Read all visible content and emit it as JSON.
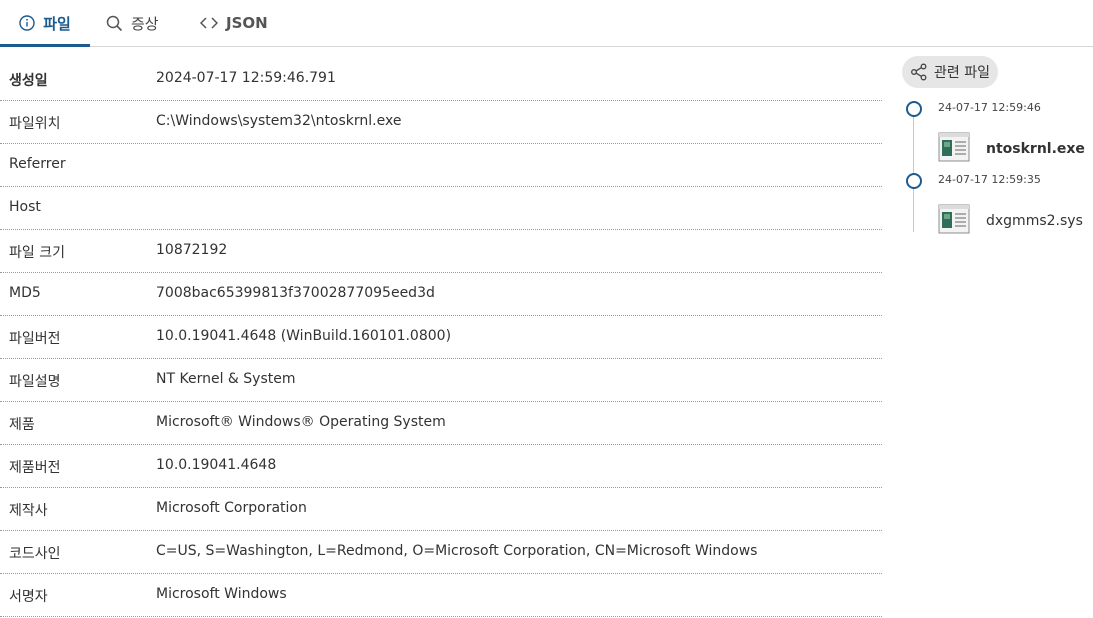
{
  "tabs": {
    "file": "파일",
    "symptom": "증상",
    "json": "JSON"
  },
  "details": [
    {
      "label": "생성일",
      "value": "2024-07-17 12:59:46.791"
    },
    {
      "label": "파일위치",
      "value": "C:\\Windows\\system32\\ntoskrnl.exe"
    },
    {
      "label": "Referrer",
      "value": ""
    },
    {
      "label": "Host",
      "value": ""
    },
    {
      "label": "파일 크기",
      "value": "10872192"
    },
    {
      "label": "MD5",
      "value": "7008bac65399813f37002877095eed3d"
    },
    {
      "label": "파일버전",
      "value": "10.0.19041.4648 (WinBuild.160101.0800)"
    },
    {
      "label": "파일설명",
      "value": "NT Kernel & System"
    },
    {
      "label": "제품",
      "value": "Microsoft® Windows® Operating System"
    },
    {
      "label": "제품버전",
      "value": "10.0.19041.4648"
    },
    {
      "label": "제작사",
      "value": "Microsoft Corporation"
    },
    {
      "label": "코드사인",
      "value": "C=US, S=Washington, L=Redmond, O=Microsoft Corporation, CN=Microsoft Windows"
    },
    {
      "label": "서명자",
      "value": "Microsoft Windows"
    }
  ],
  "related": {
    "button_label": "관련 파일",
    "items": [
      {
        "date": "24-07-17 12:59:46",
        "name": "ntoskrnl.exe"
      },
      {
        "date": "24-07-17 12:59:35",
        "name": "dxgmms2.sys"
      }
    ]
  },
  "colors": {
    "accent": "#1d5b8e",
    "divider": "#9a9a9a",
    "pill_bg": "#e6e6e6"
  },
  "icons": {
    "file_tab": "info-icon",
    "symptom_tab": "search-icon",
    "json_tab": "code-icon",
    "related": "share-icon",
    "file": "window-file-icon"
  }
}
